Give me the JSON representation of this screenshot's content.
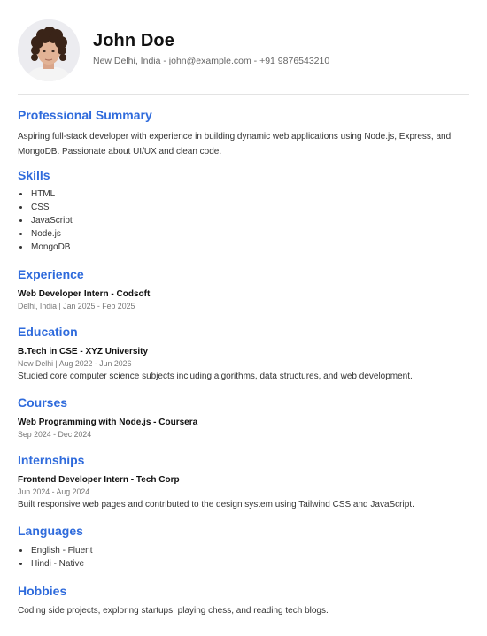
{
  "profile": {
    "name": "John Doe",
    "contact": "New Delhi, India - john@example.com - +91 9876543210"
  },
  "summary": {
    "title": "Professional Summary",
    "text": "Aspiring full-stack developer with experience in building dynamic web applications using Node.js, Express, and MongoDB. Passionate about UI/UX and clean code."
  },
  "skills": {
    "title": "Skills",
    "items": [
      "HTML",
      "CSS",
      "JavaScript",
      "Node.js",
      "MongoDB"
    ]
  },
  "experience": {
    "title": "Experience",
    "entries": [
      {
        "heading": "Web Developer Intern - Codsoft",
        "meta": "Delhi, India | Jan 2025 - Feb 2025"
      }
    ]
  },
  "education": {
    "title": "Education",
    "entries": [
      {
        "heading": "B.Tech in CSE - XYZ University",
        "meta": "New Delhi | Aug 2022 - Jun 2026",
        "description": "Studied core computer science subjects including algorithms, data structures, and web development."
      }
    ]
  },
  "courses": {
    "title": "Courses",
    "entries": [
      {
        "heading": "Web Programming with Node.js - Coursera",
        "meta": "Sep 2024 - Dec 2024"
      }
    ]
  },
  "internships": {
    "title": "Internships",
    "entries": [
      {
        "heading": "Frontend Developer Intern - Tech Corp",
        "meta": "Jun 2024 - Aug 2024",
        "description": "Built responsive web pages and contributed to the design system using Tailwind CSS and JavaScript."
      }
    ]
  },
  "languages": {
    "title": "Languages",
    "items": [
      "English - Fluent",
      "Hindi - Native"
    ]
  },
  "hobbies": {
    "title": "Hobbies",
    "text": "Coding side projects, exploring startups, playing chess, and reading tech blogs."
  },
  "colors": {
    "accent": "#2f6bdc",
    "divider": "#e3e3e3"
  }
}
